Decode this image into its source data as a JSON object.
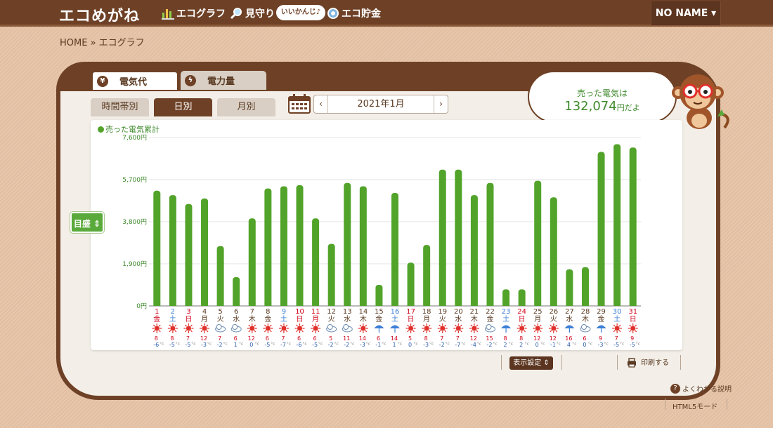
{
  "header": {
    "logo": "エコめがね",
    "nav": [
      {
        "label": "エコグラフ",
        "icon": "bar-chart-icon"
      },
      {
        "label": "見守り",
        "icon": "magnifier-icon"
      },
      {
        "label": "エコ貯金",
        "icon": "coin-icon"
      }
    ],
    "bubble": "いいかんじ♪",
    "user": "NO NAME ▾"
  },
  "breadcrumb": "HOME » エコグラフ",
  "main_tabs": [
    {
      "label": "電気代",
      "icon": "yen-icon",
      "active": true
    },
    {
      "label": "電力量",
      "icon": "lightning-icon",
      "active": false
    }
  ],
  "sub_tabs": [
    {
      "label": "時間帯別",
      "active": false
    },
    {
      "label": "日別",
      "active": true
    },
    {
      "label": "月別",
      "active": false
    }
  ],
  "date": {
    "prev": "‹",
    "next": "›",
    "year_month": "2021年1月"
  },
  "speech": {
    "line1": "売った電気は",
    "amount": "132,074",
    "suffix": "円だよ"
  },
  "controls": {
    "mesen": "目盛 ⇕",
    "display_settings": "表示設定 ⇕",
    "print": "印刷する",
    "help": "よくわかる説明",
    "help_icon": "?",
    "html5": "HTML5モード"
  },
  "chart_data": {
    "type": "bar",
    "legend": "売った電気累計",
    "ylim": [
      0,
      7600
    ],
    "yticks": [
      "0円",
      "1,900円",
      "3,800円",
      "5,700円",
      "7,600円"
    ],
    "ytick_values": [
      0,
      1900,
      3800,
      5700,
      7600
    ],
    "color": "#52a32a",
    "categories": [
      "1",
      "2",
      "3",
      "4",
      "5",
      "6",
      "7",
      "8",
      "9",
      "10",
      "11",
      "12",
      "13",
      "14",
      "15",
      "16",
      "17",
      "18",
      "19",
      "20",
      "21",
      "22",
      "23",
      "24",
      "25",
      "26",
      "27",
      "28",
      "29",
      "30",
      "31"
    ],
    "weekdays": [
      "金",
      "土",
      "日",
      "月",
      "火",
      "水",
      "木",
      "金",
      "土",
      "日",
      "月",
      "火",
      "水",
      "木",
      "金",
      "土",
      "日",
      "月",
      "火",
      "水",
      "木",
      "金",
      "土",
      "日",
      "月",
      "火",
      "水",
      "木",
      "金",
      "土",
      "日"
    ],
    "day_colors": [
      "#d0021b",
      "#3c7fd6",
      "#d0021b",
      "#5a3a22",
      "#5a3a22",
      "#5a3a22",
      "#5a3a22",
      "#5a3a22",
      "#3c7fd6",
      "#d0021b",
      "#d0021b",
      "#5a3a22",
      "#5a3a22",
      "#5a3a22",
      "#5a3a22",
      "#3c7fd6",
      "#d0021b",
      "#5a3a22",
      "#5a3a22",
      "#5a3a22",
      "#5a3a22",
      "#5a3a22",
      "#3c7fd6",
      "#d0021b",
      "#5a3a22",
      "#5a3a22",
      "#5a3a22",
      "#5a3a22",
      "#5a3a22",
      "#3c7fd6",
      "#d0021b"
    ],
    "values": [
      5200,
      5000,
      4600,
      4850,
      2700,
      1300,
      3950,
      5300,
      5400,
      5450,
      3950,
      2800,
      5550,
      5400,
      950,
      5100,
      1950,
      2750,
      6150,
      6150,
      5000,
      5550,
      750,
      750,
      5650,
      4900,
      1650,
      1750,
      6950,
      7300,
      7150
    ],
    "weather": [
      "sun",
      "sun",
      "sun",
      "sun",
      "cloud",
      "cloud",
      "sun",
      "sun",
      "sun",
      "sun",
      "sun",
      "cloud",
      "cloud",
      "sun",
      "rain",
      "rain",
      "sun",
      "sun",
      "sun",
      "sun",
      "sun",
      "cloud",
      "rain",
      "sun",
      "sun",
      "sun",
      "rain",
      "cloud",
      "rain",
      "sun",
      "sun"
    ],
    "high_temps": [
      "8",
      "8",
      "7",
      "12",
      "7",
      "6",
      "12",
      "6",
      "7",
      "6",
      "6",
      "5",
      "11",
      "14",
      "6",
      "14",
      "5",
      "8",
      "7",
      "7",
      "12",
      "15",
      "8",
      "8",
      "12",
      "12",
      "16",
      "6",
      "9",
      "7",
      "9"
    ],
    "low_temps": [
      "-6",
      "-5",
      "-5",
      "-3",
      "-2",
      "1",
      "0",
      "-5",
      "-7",
      "-6",
      "-5",
      "-2",
      "-2",
      "-3",
      "-1",
      "1",
      "0",
      "-3",
      "-2",
      "-7",
      "-4",
      "-2",
      "2",
      "2",
      "0",
      "-1",
      "4",
      "0",
      "-3",
      "-5",
      "-5"
    ],
    "temp_unit": "°c"
  }
}
